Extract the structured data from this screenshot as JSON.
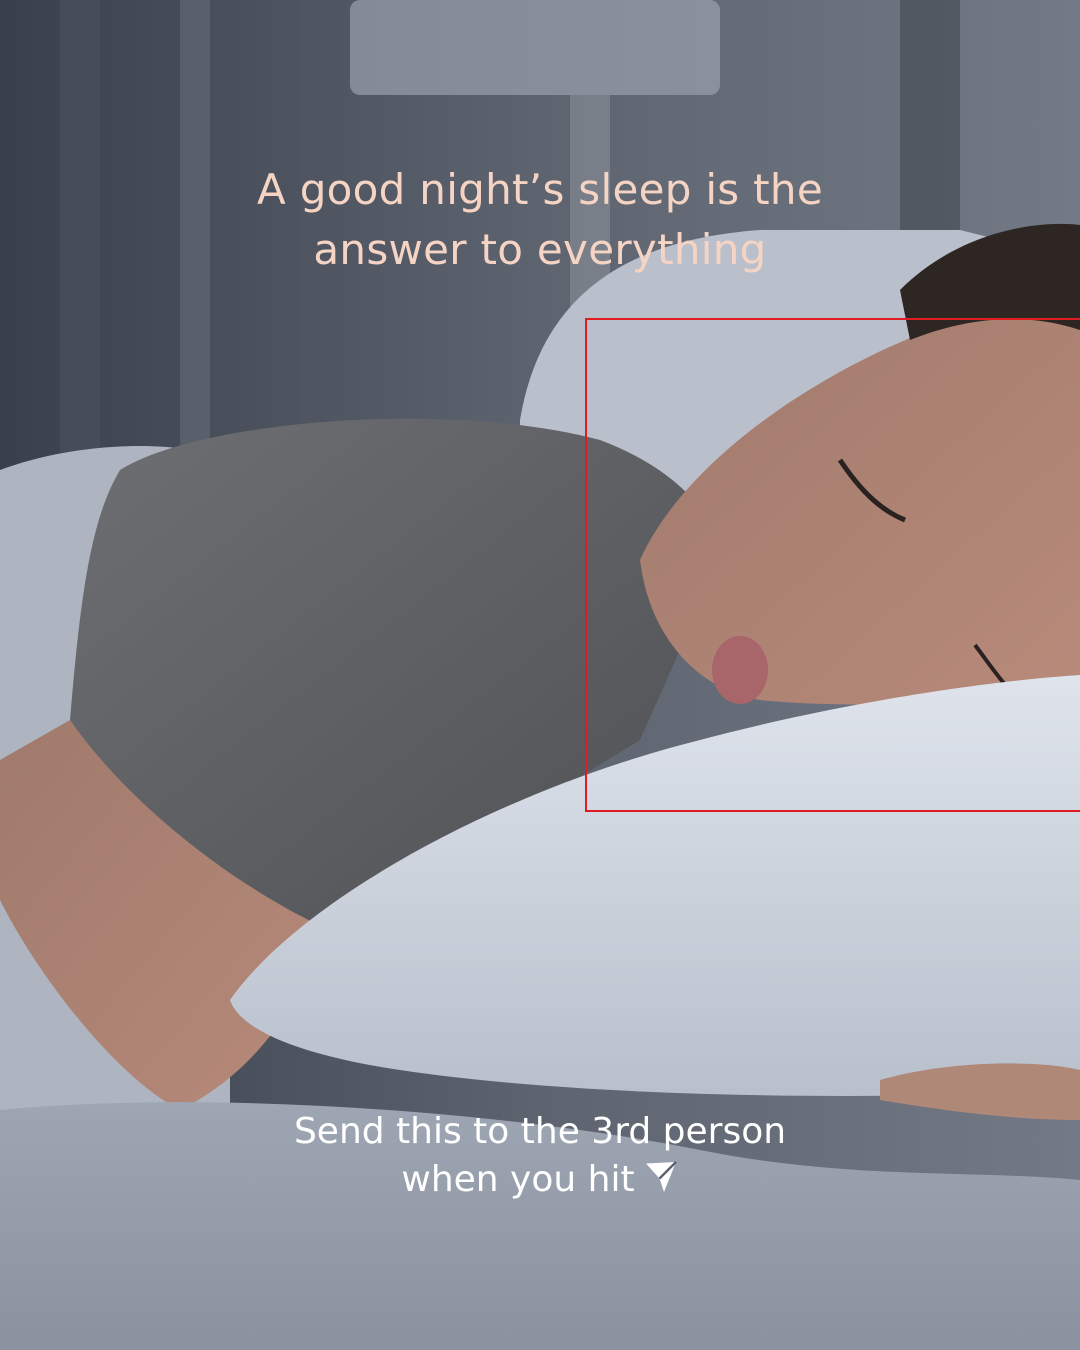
{
  "headline": {
    "line1": "A good night’s sleep is the",
    "line2": "answer to everything"
  },
  "cta": {
    "line1": "Send this to the 3rd person",
    "line2": "when you hit",
    "icon": "paper-plane-send-icon"
  },
  "colors": {
    "headline": "#f6d4c4",
    "cta": "#ffffff",
    "highlight_box": "#e01b22"
  }
}
